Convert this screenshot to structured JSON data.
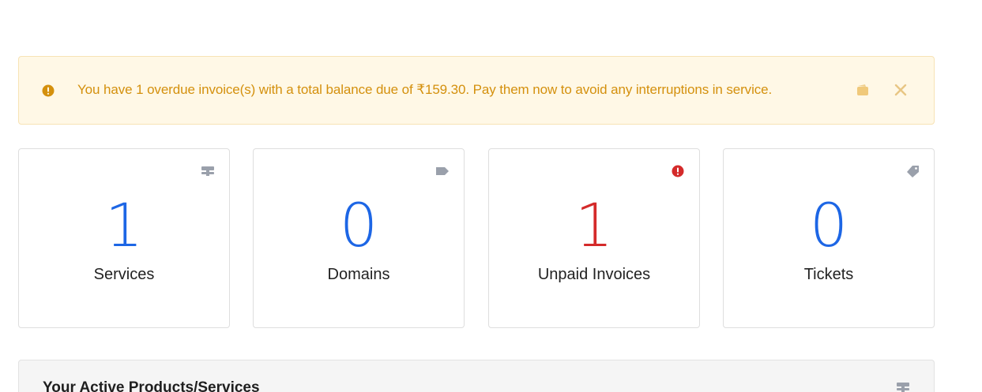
{
  "alert": {
    "icon": "exclamation-circle-icon",
    "message": "You have 1 overdue invoice(s) with a total balance due of ₹159.30. Pay them now to avoid any interruptions in service.",
    "pay_icon": "wallet-icon",
    "close_icon": "close-icon",
    "color": "#d4900d",
    "background": "#fff8e6"
  },
  "tiles": [
    {
      "value": "1",
      "label": "Services",
      "icon": "server-icon"
    },
    {
      "value": "0",
      "label": "Domains",
      "icon": "tag-icon"
    },
    {
      "value": "1",
      "label": "Unpaid Invoices",
      "icon": "exclamation-circle-icon"
    },
    {
      "value": "0",
      "label": "Tickets",
      "icon": "ticket-tag-icon"
    }
  ],
  "colors": {
    "accent": "#1d66e5",
    "danger": "#d42a2a",
    "icon_muted": "#9aa0ab"
  },
  "active_products": {
    "title": "Your Active Products/Services",
    "icon": "server-icon"
  }
}
